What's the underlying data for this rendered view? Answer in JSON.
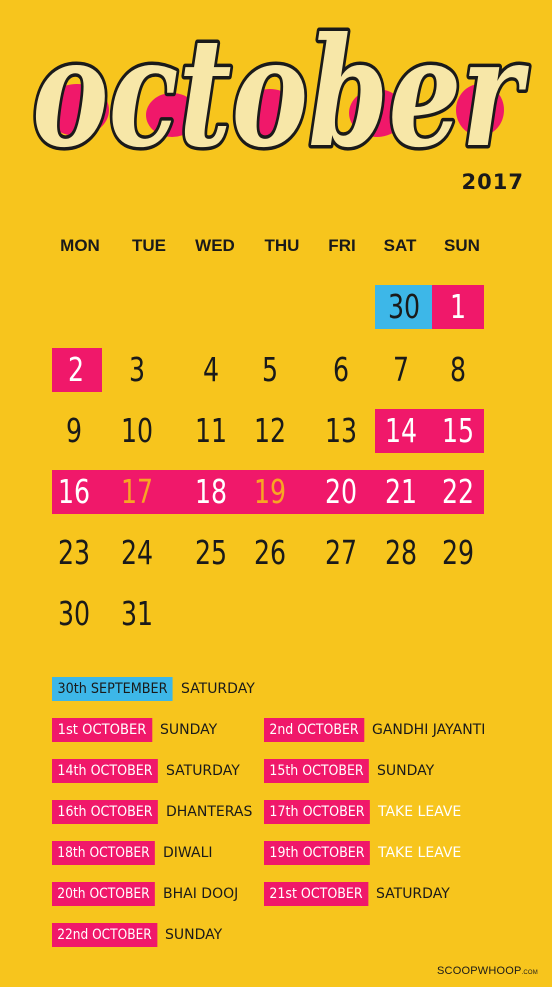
{
  "header": {
    "month": "october",
    "year": "2017"
  },
  "weekdays": [
    "MON",
    "TUE",
    "WED",
    "THU",
    "FRI",
    "SAT",
    "SUN"
  ],
  "colors": {
    "background": "#f7c51d",
    "pink": "#f0186a",
    "blue": "#3db7e8",
    "dark": "#1a1a1a",
    "orange": "#f7a623"
  },
  "weeks": [
    [
      "",
      "",
      "",
      "",
      "",
      "30",
      "1"
    ],
    [
      "2",
      "3",
      "4",
      "5",
      "6",
      "7",
      "8"
    ],
    [
      "9",
      "10",
      "11",
      "12",
      "13",
      "14",
      "15"
    ],
    [
      "16",
      "17",
      "18",
      "19",
      "20",
      "21",
      "22"
    ],
    [
      "23",
      "24",
      "25",
      "26",
      "27",
      "28",
      "29"
    ],
    [
      "30",
      "31",
      "",
      "",
      "",
      "",
      ""
    ]
  ],
  "legend": [
    {
      "tag": "30th SEPTEMBER",
      "desc": "SATURDAY"
    },
    {
      "tag": "1st OCTOBER",
      "desc": "SUNDAY"
    },
    {
      "tag": "2nd OCTOBER",
      "desc": "GANDHI JAYANTI"
    },
    {
      "tag": "14th OCTOBER",
      "desc": "SATURDAY"
    },
    {
      "tag": "15th OCTOBER",
      "desc": "SUNDAY"
    },
    {
      "tag": "16th OCTOBER",
      "desc": "DHANTERAS"
    },
    {
      "tag": "17th OCTOBER",
      "desc": "TAKE LEAVE"
    },
    {
      "tag": "18th OCTOBER",
      "desc": "DIWALI"
    },
    {
      "tag": "19th OCTOBER",
      "desc": "TAKE LEAVE"
    },
    {
      "tag": "20th OCTOBER",
      "desc": "BHAI DOOJ"
    },
    {
      "tag": "21st OCTOBER",
      "desc": "SATURDAY"
    },
    {
      "tag": "22nd OCTOBER",
      "desc": "SUNDAY"
    }
  ],
  "brand": {
    "name": "SCOOPWHOOP",
    "suffix": ".COM"
  }
}
